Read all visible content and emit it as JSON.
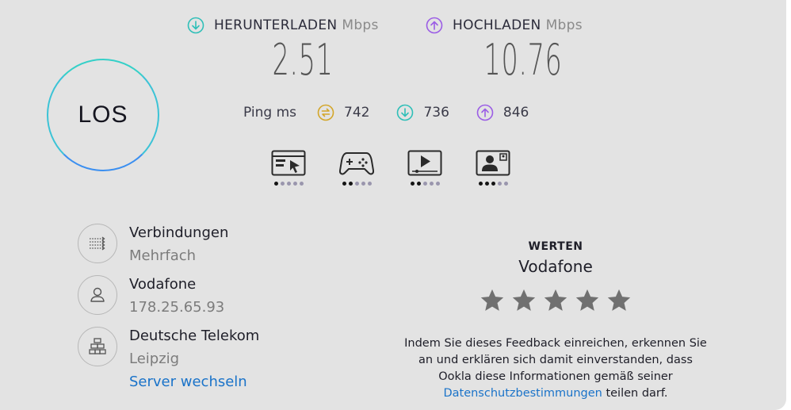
{
  "colors": {
    "download": "#2fbfb8",
    "upload": "#9b5de5",
    "ping": "#d3a62a",
    "link": "#1a73c9"
  },
  "download": {
    "label": "HERUNTERLADEN",
    "unit": "Mbps",
    "value": "2.51",
    "icon": "arrow-down-circle-icon"
  },
  "upload": {
    "label": "HOCHLADEN",
    "unit": "Mbps",
    "value": "10.76",
    "icon": "arrow-up-circle-icon"
  },
  "ping": {
    "label": "Ping ms",
    "idle": "742",
    "download": "736",
    "upload": "846"
  },
  "go_button": {
    "label": "LOS"
  },
  "apps": [
    {
      "name": "browsing-icon",
      "rating": 1,
      "max": 5
    },
    {
      "name": "gaming-icon",
      "rating": 2,
      "max": 5
    },
    {
      "name": "streaming-icon",
      "rating": 2,
      "max": 5
    },
    {
      "name": "video-call-icon",
      "rating": 3,
      "max": 5
    }
  ],
  "connections": {
    "title": "Verbindungen",
    "value": "Mehrfach",
    "icon": "connections-icon"
  },
  "isp": {
    "title": "Vodafone",
    "ip": "178.25.65.93",
    "icon": "user-icon"
  },
  "server": {
    "title": "Deutsche Telekom",
    "location": "Leipzig",
    "change_link": "Server wechseln",
    "icon": "server-icon"
  },
  "rating": {
    "heading": "WERTEN",
    "isp": "Vodafone",
    "stars": 5,
    "consent_line1": "Indem Sie dieses Feedback einreichen, erkennen Sie",
    "consent_line2": "an und erklären sich damit einverstanden, dass",
    "consent_line3": "Ookla diese Informationen gemäß seiner",
    "consent_link": "Datenschutzbestimmungen",
    "consent_tail": "teilen darf."
  }
}
